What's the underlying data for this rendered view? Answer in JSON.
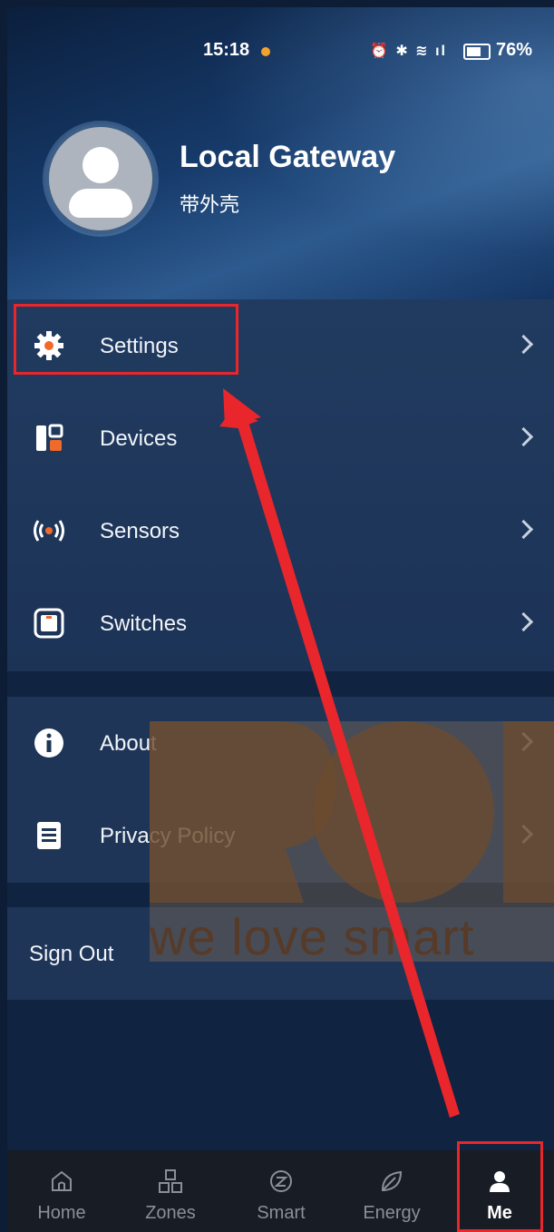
{
  "status_bar": {
    "time": "15:18",
    "battery": "76%"
  },
  "profile": {
    "name": "Local Gateway",
    "subtitle": "带外壳"
  },
  "menu": {
    "group1": [
      {
        "label": "Settings",
        "icon": "gear-icon"
      },
      {
        "label": "Devices",
        "icon": "devices-icon"
      },
      {
        "label": "Sensors",
        "icon": "sensor-icon"
      },
      {
        "label": "Switches",
        "icon": "switch-icon"
      }
    ],
    "group2": [
      {
        "label": "About",
        "icon": "info-icon"
      },
      {
        "label": "Privacy Policy",
        "icon": "document-icon"
      }
    ],
    "sign_out": "Sign Out"
  },
  "tabbar": [
    {
      "label": "Home",
      "icon": "home-icon",
      "active": false
    },
    {
      "label": "Zones",
      "icon": "zones-icon",
      "active": false
    },
    {
      "label": "Smart",
      "icon": "smart-icon",
      "active": false
    },
    {
      "label": "Energy",
      "icon": "leaf-icon",
      "active": false
    },
    {
      "label": "Me",
      "icon": "person-icon",
      "active": true
    }
  ],
  "watermark": {
    "text": "we love smart"
  },
  "colors": {
    "accent_orange": "#f06a2a",
    "highlight_red": "#e8262b",
    "background": "#102340"
  }
}
